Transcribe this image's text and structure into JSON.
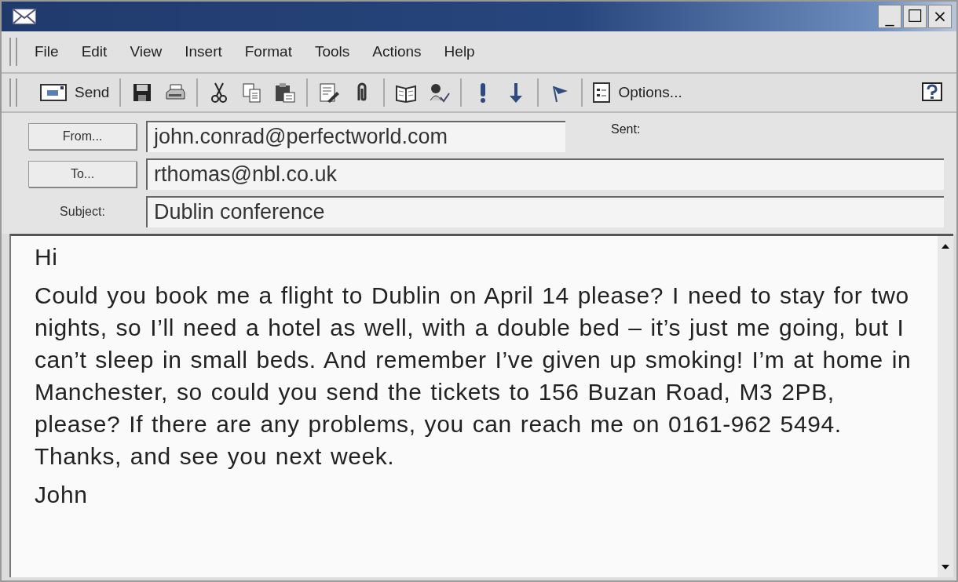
{
  "window": {
    "title_buttons": [
      "_",
      "☐",
      "×"
    ]
  },
  "menu": [
    "File",
    "Edit",
    "View",
    "Insert",
    "Format",
    "Tools",
    "Actions",
    "Help"
  ],
  "toolbar": {
    "send_label": "Send",
    "options_label": "Options..."
  },
  "header": {
    "from_button": "From...",
    "from_value": "john.conrad@perfectworld.com",
    "sent_label": "Sent:",
    "to_button": "To...",
    "to_value": "rthomas@nbl.co.uk",
    "subject_label": "Subject:",
    "subject_value": "Dublin conference"
  },
  "body": [
    "Hi",
    "Could you book me a flight to Dublin on April 14 please? I need to stay for two nights, so I’ll need a hotel as well, with a double bed – it’s just me going, but I can’t sleep in small beds. And remember I’ve given up smoking! I’m at home in Manchester, so could you send the tickets to 156 Buzan Road, M3 2PB, please? If there are any problems, you can reach me on 0161-962 5494. Thanks, and see you next week.",
    "John"
  ]
}
